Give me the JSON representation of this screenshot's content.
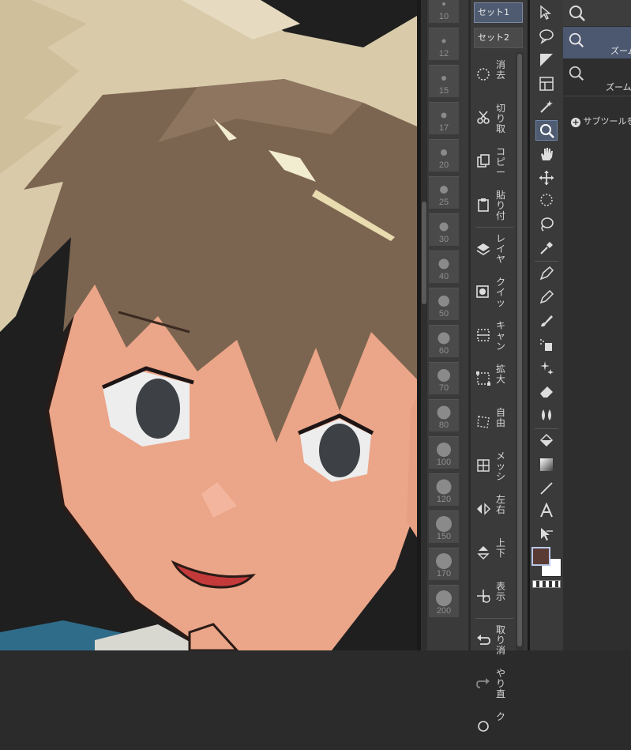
{
  "brush_sizes": [
    "10",
    "12",
    "15",
    "17",
    "20",
    "25",
    "30",
    "40",
    "50",
    "60",
    "70",
    "80",
    "100",
    "120",
    "150",
    "170",
    "200"
  ],
  "command_bar": {
    "set_tabs": [
      "セット1",
      "セット2"
    ],
    "items": [
      {
        "icon": "clear-icon",
        "label": "消去"
      },
      {
        "icon": "cut-icon",
        "label": "切り取"
      },
      {
        "icon": "copy-icon",
        "label": "コピー"
      },
      {
        "icon": "paste-icon",
        "label": "貼り付"
      },
      {
        "icon": "new-layer-icon",
        "label": "レイヤ"
      },
      {
        "icon": "quick-mask-icon",
        "label": "クイッ"
      },
      {
        "icon": "canvas-icon",
        "label": "キャン"
      },
      {
        "icon": "scale-icon",
        "label": "拡大"
      },
      {
        "icon": "free-transform-icon",
        "label": "自由"
      },
      {
        "icon": "mesh-transform-icon",
        "label": "メッシ"
      },
      {
        "icon": "flip-horizontal-icon",
        "label": "左右"
      },
      {
        "icon": "flip-vertical-icon",
        "label": "上下"
      },
      {
        "icon": "show-area-icon",
        "label": "表示"
      },
      {
        "icon": "undo-icon",
        "label": "取り消"
      },
      {
        "icon": "redo-icon",
        "label": "やり直"
      },
      {
        "icon": "quick-access-icon",
        "label": "ク"
      }
    ]
  },
  "tools": [
    "object-select",
    "speech-balloon",
    "frame-border",
    "ruler",
    "auto-select",
    "zoom",
    "hand",
    "move",
    "lasso-select",
    "lasso",
    "eyedropper",
    "pen",
    "pencil",
    "brush",
    "airbrush",
    "decoration",
    "eraser",
    "blend",
    "fill",
    "gradient",
    "line",
    "text",
    "correct-line"
  ],
  "colors": {
    "main": "#5a3b33",
    "sub": "#ffffff",
    "accent": "#4e5b70"
  },
  "sub_tool": {
    "items": [
      {
        "label": "ズーム"
      },
      {
        "label": "ズーム"
      }
    ],
    "add_label": "サブツールを追加"
  }
}
